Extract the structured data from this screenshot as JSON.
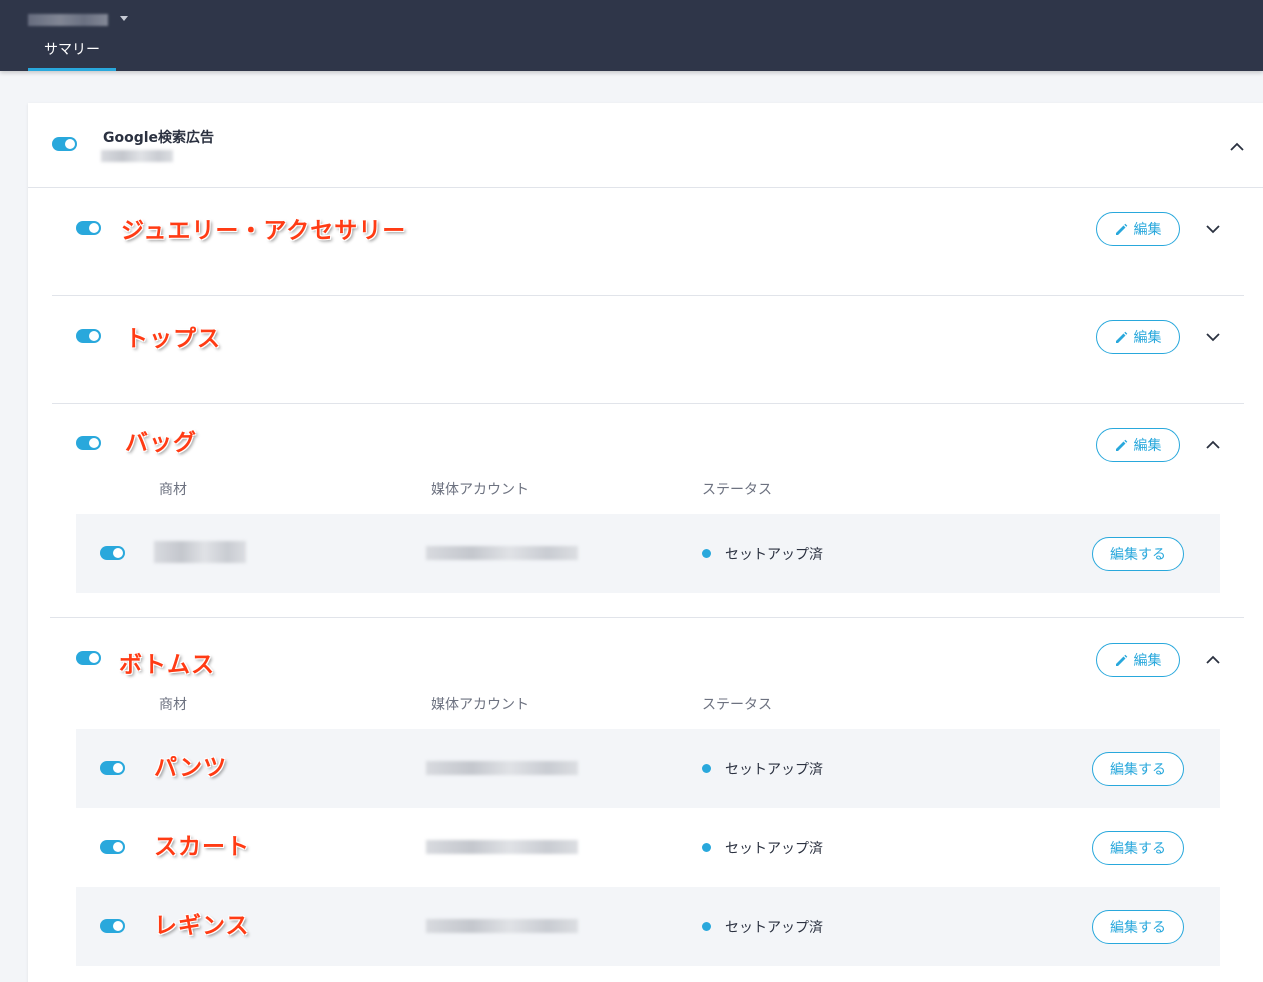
{
  "header": {
    "tabs": [
      {
        "label": "サマリー",
        "active": true
      }
    ]
  },
  "group": {
    "title": "Google検索広告",
    "expanded": true
  },
  "categories": [
    {
      "name": "ジュエリー・アクセサリー",
      "edit_label": "編集",
      "expanded": false
    },
    {
      "name": "トップス",
      "edit_label": "編集",
      "expanded": false
    },
    {
      "name": "バッグ",
      "edit_label": "編集",
      "expanded": true
    },
    {
      "name": "ボトムス",
      "edit_label": "編集",
      "expanded": true
    }
  ],
  "table": {
    "col_product": "商材",
    "col_account": "媒体アカウント",
    "col_status": "ステータス"
  },
  "rows": {
    "bag": [
      {
        "name": "",
        "status": "セットアップ済",
        "edit_label": "編集する"
      }
    ],
    "bottoms": [
      {
        "name": "パンツ",
        "status": "セットアップ済",
        "edit_label": "編集する"
      },
      {
        "name": "スカート",
        "status": "セットアップ済",
        "edit_label": "編集する"
      },
      {
        "name": "レギンス",
        "status": "セットアップ済",
        "edit_label": "編集する"
      }
    ]
  },
  "colors": {
    "header_bg": "#2f3649",
    "accent": "#29a8dc",
    "annotation": "#ff3b14"
  },
  "icons": {
    "edit": "pencil-icon",
    "collapse": "chevron-up-icon",
    "expand": "chevron-down-icon",
    "dropdown": "caret-down-icon"
  }
}
